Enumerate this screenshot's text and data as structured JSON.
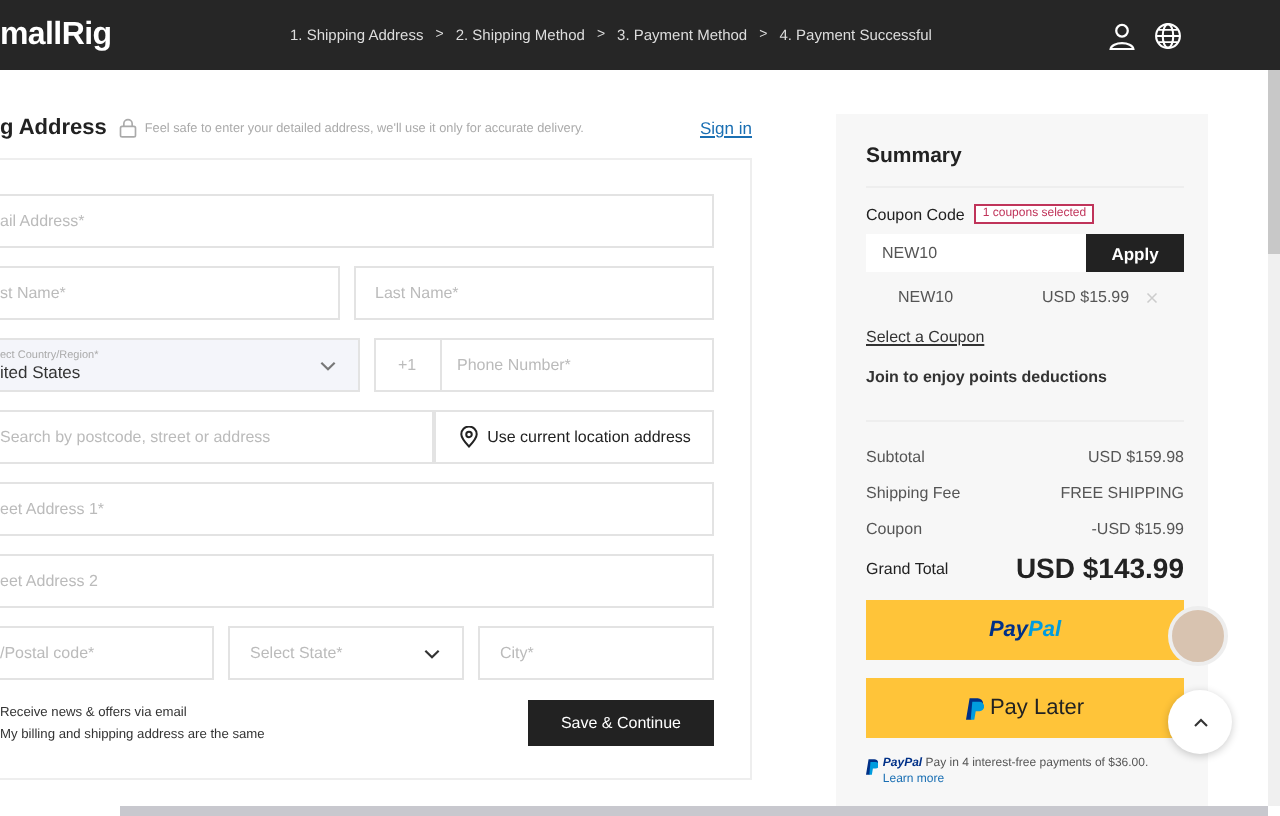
{
  "header": {
    "logo": "mallRig",
    "steps": [
      {
        "label": "1. Shipping Address",
        "separator": ">"
      },
      {
        "label": "2. Shipping Method",
        "separator": ">"
      },
      {
        "label": "3. Payment Method",
        "separator": ">"
      },
      {
        "label": "4. Payment Successful"
      }
    ]
  },
  "form": {
    "title": "g Address",
    "note": "Feel safe to enter your detailed address, we'll use it only for accurate delivery.",
    "sign_in": "Sign in",
    "rows": [
      [
        {
          "kind": "input",
          "placeholder": "ail Address*"
        }
      ],
      [
        {
          "kind": "input",
          "placeholder": "st Name*"
        },
        {
          "kind": "input",
          "placeholder": "Last Name*"
        }
      ],
      [
        {
          "kind": "select",
          "label": "ect Country/Region*",
          "value": "ited States"
        },
        {
          "kind": "phone",
          "prefix": "+1",
          "placeholder": "Phone Number*"
        }
      ],
      [
        {
          "kind": "input",
          "placeholder": "Search by postcode, street or address"
        },
        {
          "kind": "location",
          "label": "Use current location address"
        }
      ],
      [
        {
          "kind": "input",
          "placeholder": "eet Address 1*"
        }
      ],
      [
        {
          "kind": "input",
          "placeholder": "eet Address 2"
        }
      ],
      [
        {
          "kind": "input",
          "placeholder": "/Postal code*"
        },
        {
          "kind": "dropdown",
          "placeholder": "Select State*"
        },
        {
          "kind": "input",
          "placeholder": "City*"
        }
      ]
    ],
    "options": [
      "Receive news & offers via email",
      "My billing and shipping address are the same"
    ],
    "submit": "Save & Continue"
  },
  "summary": {
    "title": "Summary",
    "coupon_label": "Coupon Code",
    "coupon_badge": "1 coupons selected",
    "coupon_value": "NEW10",
    "apply": "Apply",
    "applied": {
      "code": "NEW10",
      "amount": "USD $15.99"
    },
    "select_coupon": "Select a Coupon",
    "points": "Join to enjoy points deductions",
    "totals": [
      {
        "label": "Subtotal",
        "value": "USD $159.98"
      },
      {
        "label": "Shipping Fee",
        "value": "FREE SHIPPING"
      },
      {
        "label": "Coupon",
        "value": "-USD $15.99"
      }
    ],
    "grand_total": {
      "label": "Grand Total",
      "value": "USD $143.99"
    },
    "paypal": [
      "Pay",
      "Pal"
    ],
    "pay_later": "Pay Later",
    "message": {
      "brand": "PayPal",
      "text": "Pay in 4 interest-free payments of $36.00.",
      "link": "Learn more"
    }
  }
}
